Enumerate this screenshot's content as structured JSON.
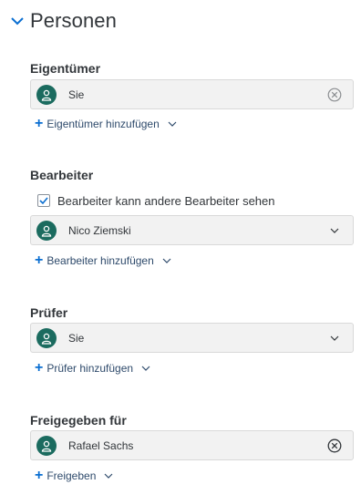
{
  "section": {
    "title": "Personen"
  },
  "owner": {
    "label": "Eigentümer",
    "value": "Sie",
    "add_label": "Eigentümer hinzufügen"
  },
  "editors": {
    "label": "Bearbeiter",
    "checkbox_label": "Bearbeiter kann andere Bearbeiter sehen",
    "checkbox_checked": true,
    "value": "Nico Ziemski",
    "add_label": "Bearbeiter hinzufügen"
  },
  "reviewer": {
    "label": "Prüfer",
    "value": "Sie",
    "add_label": "Prüfer hinzufügen"
  },
  "shared": {
    "label": "Freigegeben für",
    "value": "Rafael Sachs",
    "add_label": "Freigeben"
  },
  "colors": {
    "avatar": "#1b6b5f",
    "link": "#0a6ed1",
    "field_bg": "#f2f2f2"
  },
  "icons": {
    "collapse": "chevron-down-icon",
    "avatar": "person-icon",
    "clear": "clear-circle-icon",
    "dropdown": "chevron-down-icon",
    "add": "plus-icon"
  }
}
